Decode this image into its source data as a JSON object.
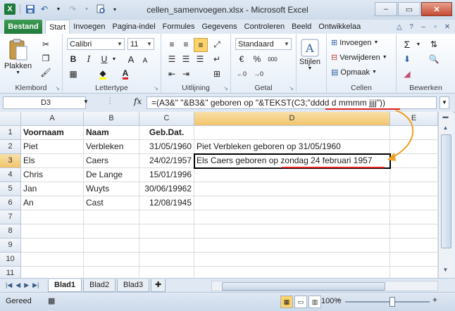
{
  "window": {
    "title": "cellen_samenvoegen.xlsx - Microsoft Excel",
    "app_icon": "X"
  },
  "ribbon_tabs": {
    "file": "Bestand",
    "tabs": [
      "Start",
      "Invoegen",
      "Pagina-indel",
      "Formules",
      "Gegevens",
      "Controleren",
      "Beeld",
      "Ontwikkelaa"
    ]
  },
  "ribbon": {
    "clipboard": {
      "paste": "Plakken",
      "label": "Klembord"
    },
    "font": {
      "name": "Calibri",
      "size": "11",
      "label": "Lettertype",
      "bold": "B",
      "italic": "I",
      "underline": "U",
      "grow": "A",
      "shrink": "A"
    },
    "alignment": {
      "label": "Uitlijning"
    },
    "number": {
      "format": "Standaard",
      "currency": "€",
      "percent": "%",
      "thousands": "000",
      "label": "Getal"
    },
    "styles": {
      "label": "Stijlen"
    },
    "cells": {
      "insert": "Invoegen",
      "delete": "Verwijderen",
      "format": "Opmaak",
      "label": "Cellen"
    },
    "editing": {
      "sum": "Σ",
      "label": "Bewerken"
    }
  },
  "formula_bar": {
    "name_box": "D3",
    "fx": "fx",
    "formula": "=(A3&\" \"&B3&\" geboren op \"&TEKST(C3;\"dddd d mmmm jjjj\"))"
  },
  "columns": [
    "A",
    "B",
    "C",
    "D",
    "E"
  ],
  "rows": [
    {
      "n": "1",
      "a": "Voornaam",
      "b": "Naam",
      "c": "Geb.Dat.",
      "d": ""
    },
    {
      "n": "2",
      "a": "Piet",
      "b": "Verbleken",
      "c": "31/05/1960",
      "d": "Piet Verbleken geboren op 31/05/1960"
    },
    {
      "n": "3",
      "a": "Els",
      "b": "Caers",
      "c": "24/02/1957",
      "d": "Els Caers geboren op zondag 24 februari 1957"
    },
    {
      "n": "4",
      "a": "Chris",
      "b": "De Lange",
      "c": "15/01/1996",
      "d": ""
    },
    {
      "n": "5",
      "a": "Jan",
      "b": "Wuyts",
      "c": "30/06/19962",
      "d": ""
    },
    {
      "n": "6",
      "a": "An",
      "b": "Cast",
      "c": "12/08/1945",
      "d": ""
    },
    {
      "n": "7",
      "a": "",
      "b": "",
      "c": "",
      "d": ""
    },
    {
      "n": "8",
      "a": "",
      "b": "",
      "c": "",
      "d": ""
    },
    {
      "n": "9",
      "a": "",
      "b": "",
      "c": "",
      "d": ""
    },
    {
      "n": "10",
      "a": "",
      "b": "",
      "c": "",
      "d": ""
    },
    {
      "n": "11",
      "a": "",
      "b": "",
      "c": "",
      "d": ""
    }
  ],
  "sheet_tabs": [
    "Blad1",
    "Blad2",
    "Blad3"
  ],
  "status": {
    "ready": "Gereed",
    "zoom": "100%"
  }
}
